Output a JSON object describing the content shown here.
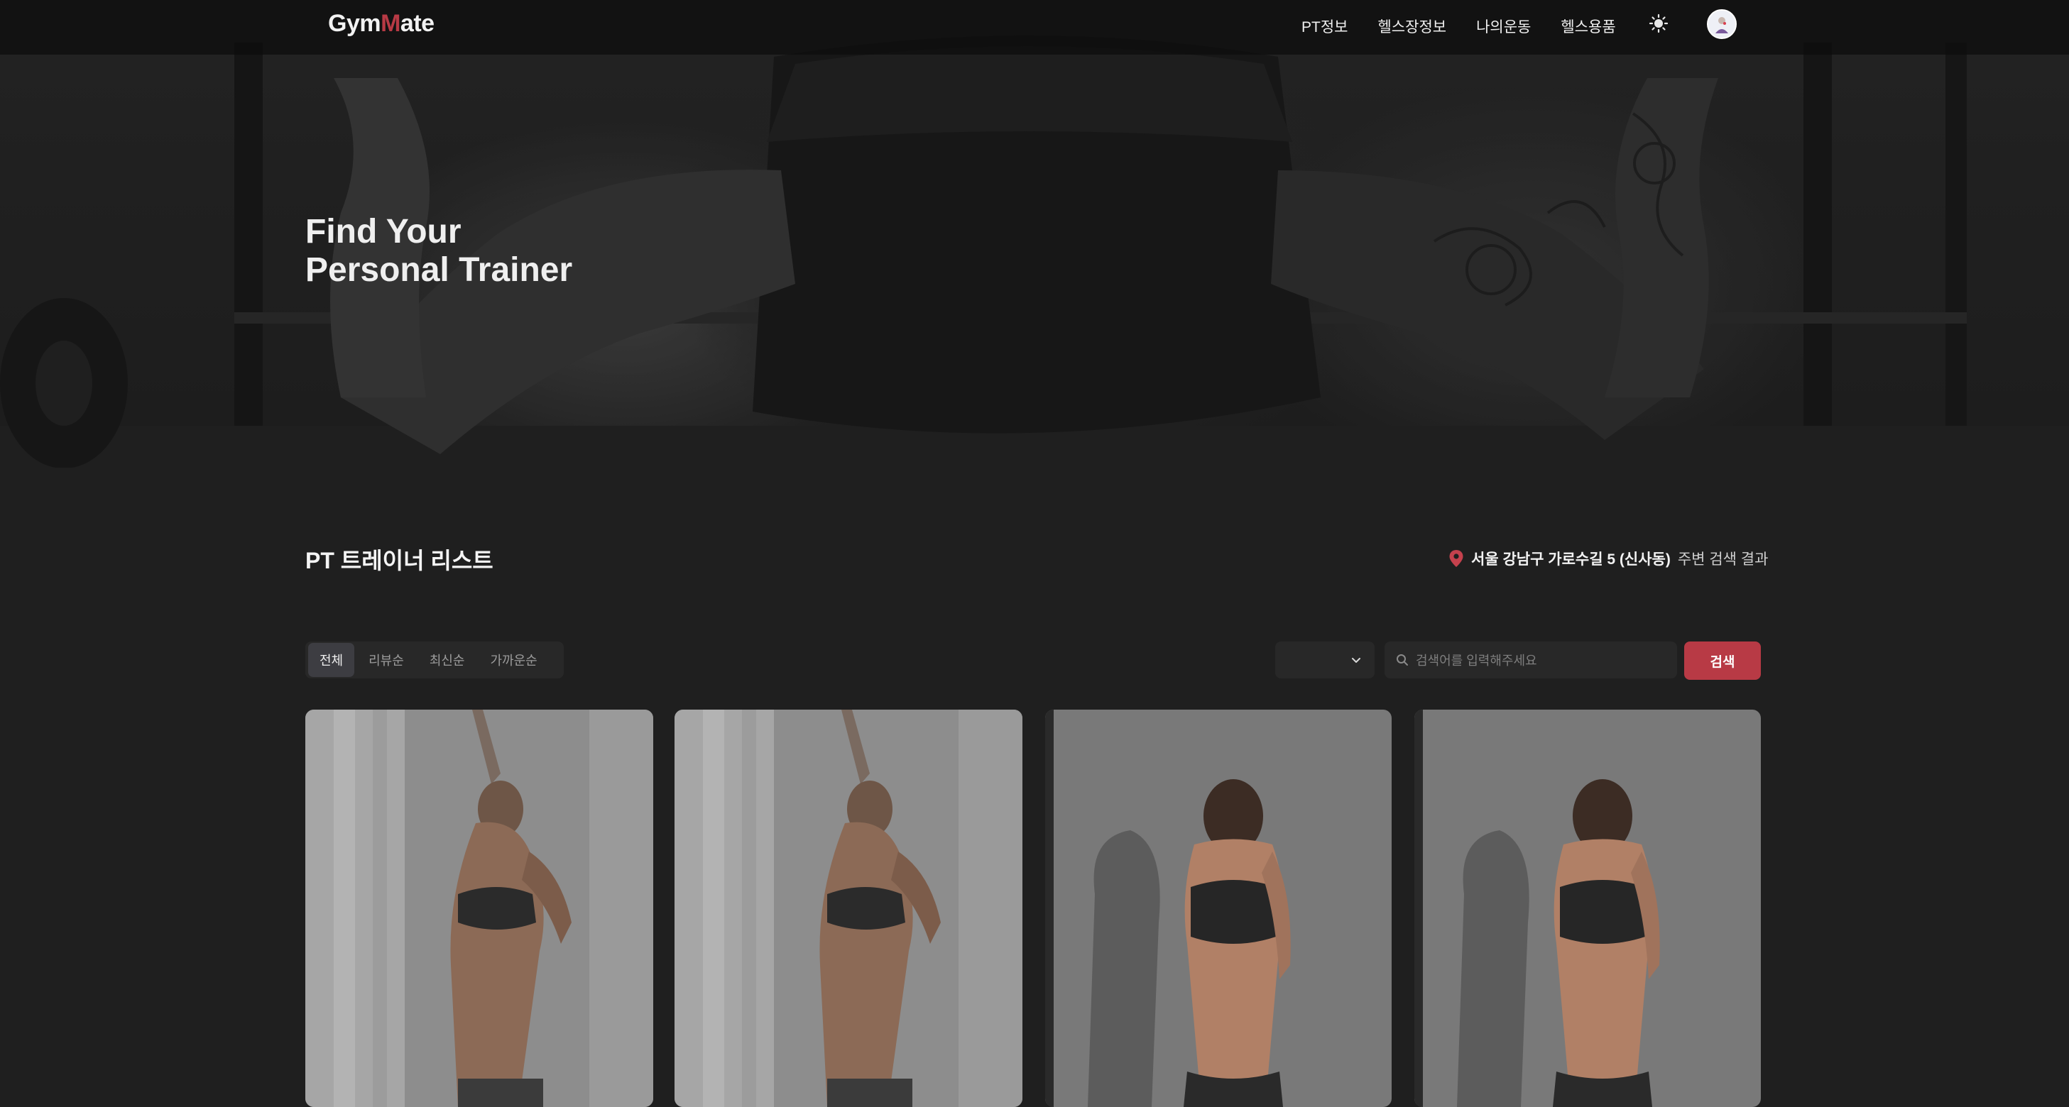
{
  "header": {
    "logo": {
      "prefix": "Gym",
      "accent": "M",
      "suffix": "ate"
    },
    "nav": [
      "PT정보",
      "헬스장정보",
      "나의운동",
      "헬스용품"
    ],
    "theme_icon": "sun-icon",
    "avatar_icon": "user-avatar"
  },
  "hero": {
    "title": "Find Your\nPersonal Trainer"
  },
  "section": {
    "title": "PT 트레이너 리스트",
    "location_address": "서울 강남구 가로수길 5 (신사동)",
    "location_suffix": "주변 검색 결과"
  },
  "filters": {
    "sort_options": [
      "전체",
      "리뷰순",
      "최신순",
      "가까운순"
    ],
    "active_sort": "전체",
    "select_value": "",
    "search_placeholder": "검색어를 입력해주세요",
    "search_value": "",
    "search_button": "검색"
  },
  "cards": [
    {
      "photo": "trainer-photo",
      "variant": "window-pose"
    },
    {
      "photo": "trainer-photo",
      "variant": "window-pose"
    },
    {
      "photo": "trainer-photo",
      "variant": "studio-pose"
    },
    {
      "photo": "trainer-photo",
      "variant": "studio-pose"
    }
  ],
  "colors": {
    "accent": "#b83a45",
    "background": "#1f1f1f",
    "surface": "#282828"
  }
}
